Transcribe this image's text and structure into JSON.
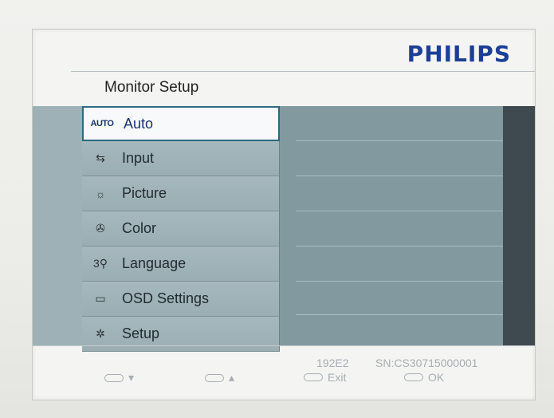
{
  "brand": "PHILIPS",
  "title": "Monitor Setup",
  "menu": {
    "items": [
      {
        "icon_text": "AUTO",
        "label": "Auto",
        "selected": true
      },
      {
        "icon_text": "⇆",
        "label": "Input"
      },
      {
        "icon_text": "☼",
        "label": "Picture"
      },
      {
        "icon_text": "✇",
        "label": "Color"
      },
      {
        "icon_text": "3⚲",
        "label": "Language"
      },
      {
        "icon_text": "▭",
        "label": "OSD Settings"
      },
      {
        "icon_text": "✲",
        "label": "Setup"
      }
    ]
  },
  "footer": {
    "model": "192E2",
    "serial": "SN:CS30715000001",
    "buttons": {
      "down": "▾",
      "up": "▴",
      "exit": "Exit",
      "ok": "OK"
    }
  },
  "colors": {
    "brand": "#1c3f95",
    "selected_border": "#2c6a82",
    "menu_bg": "#9aaeb3"
  }
}
